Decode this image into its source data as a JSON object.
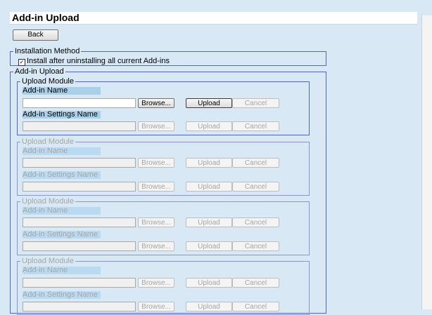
{
  "page": {
    "title": "Add-in Upload"
  },
  "toolbar": {
    "back_label": "Back"
  },
  "installation": {
    "legend": "Installation Method",
    "checkbox_label": "Install after uninstalling all current Add-ins",
    "checked": true
  },
  "upload": {
    "legend": "Add-in Upload",
    "modules": [
      {
        "legend": "Upload Module",
        "name_label": "Add-in Name",
        "settings_label": "Add-in Settings Name",
        "enabled": true
      },
      {
        "legend": "Upload Module",
        "name_label": "Add-in Name",
        "settings_label": "Add-in Settings Name",
        "enabled": false
      },
      {
        "legend": "Upload Module",
        "name_label": "Add-in Name",
        "settings_label": "Add-in Settings Name",
        "enabled": false
      },
      {
        "legend": "Upload Module",
        "name_label": "Add-in Name",
        "settings_label": "Add-in Settings Name",
        "enabled": false
      }
    ],
    "browse_label": "Browse...",
    "upload_label": "Upload",
    "cancel_label": "Cancel"
  }
}
